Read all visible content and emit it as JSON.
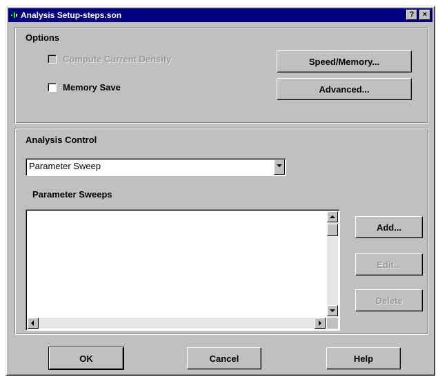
{
  "window": {
    "title": "Analysis Setup-steps.son",
    "help_glyph": "?",
    "close_glyph": "×"
  },
  "options": {
    "heading": "Options",
    "compute_current_density": {
      "label": "Compute Current Density",
      "checked": false,
      "enabled": false
    },
    "memory_save": {
      "label": "Memory Save",
      "checked": false,
      "enabled": true
    },
    "speed_memory_button": "Speed/Memory...",
    "advanced_button": "Advanced..."
  },
  "analysis_control": {
    "heading": "Analysis Control",
    "selected": "Parameter Sweep",
    "sweeps_heading": "Parameter Sweeps",
    "sweeps": [],
    "add_button": "Add...",
    "edit_button": "Edit...",
    "delete_button": "Delete"
  },
  "footer": {
    "ok_button": "OK",
    "cancel_button": "Cancel",
    "help_button": "Help"
  },
  "colors": {
    "title_bar": "#000080",
    "dialog_face": "#c0c0c0",
    "disabled_text": "#9a9a9a"
  },
  "icons": {
    "app": "app-icon",
    "help": "help-icon",
    "close": "close-icon",
    "dropdown": "chevron-down-icon"
  }
}
